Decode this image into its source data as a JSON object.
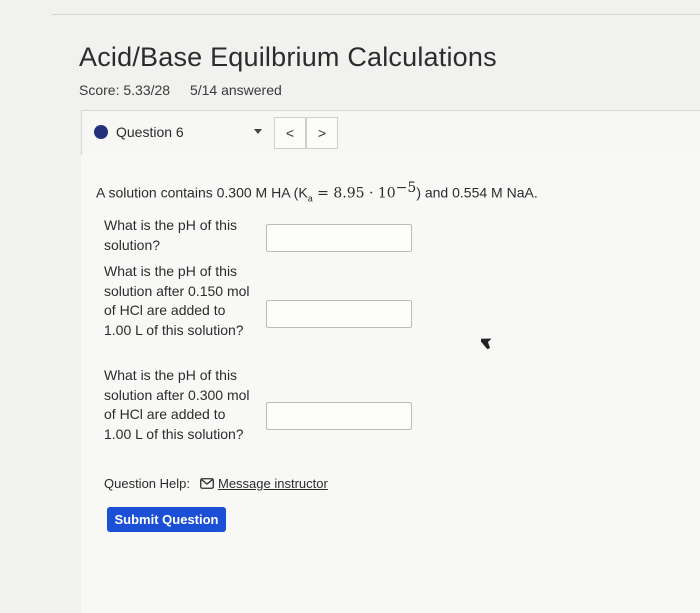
{
  "page": {
    "title": "Acid/Base Equilbrium Calculations",
    "score": "Score: 5.33/28",
    "answered": "5/14 answered"
  },
  "question_bar": {
    "selected": "Question 6",
    "prev_label": "<",
    "next_label": ">"
  },
  "problem": {
    "prefix": "A solution contains 0.300 M HA (K",
    "k_sub": "a",
    "eq": " = 8.95 · 10",
    "exp": "−5",
    "suffix": ") and 0.554 M NaA."
  },
  "questions": [
    {
      "text": "What is the pH of this solution?",
      "value": ""
    },
    {
      "text": "What is the pH of this solution after 0.150 mol of HCl are added to 1.00 L of this solution?",
      "value": ""
    },
    {
      "text": "What is the pH of this solution after 0.300 mol of HCl are added to 1.00 L of this solution?",
      "value": ""
    }
  ],
  "help": {
    "label": "Question Help:",
    "link": "Message instructor",
    "icon": "mail-icon"
  },
  "submit_label": "Submit Question",
  "colors": {
    "background": "#f1f1ef",
    "question_dot": "#24307a",
    "submit_button": "#1b4fd6"
  }
}
